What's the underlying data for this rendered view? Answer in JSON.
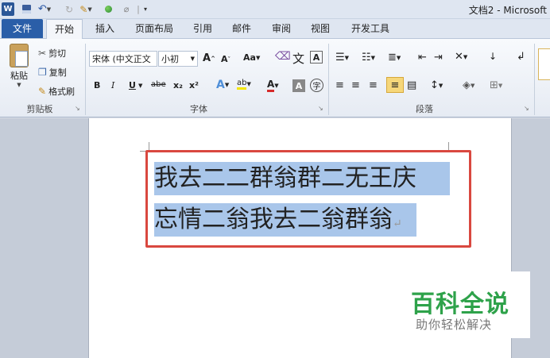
{
  "title_bar": {
    "app_icon_letter": "W",
    "window_title": "文档2 - Microsoft"
  },
  "tabs": [
    {
      "label": "文件"
    },
    {
      "label": "开始"
    },
    {
      "label": "插入"
    },
    {
      "label": "页面布局"
    },
    {
      "label": "引用"
    },
    {
      "label": "邮件"
    },
    {
      "label": "审阅"
    },
    {
      "label": "视图"
    },
    {
      "label": "开发工具"
    }
  ],
  "ribbon": {
    "clipboard": {
      "paste_label": "粘贴",
      "cut_label": "剪切",
      "copy_label": "复制",
      "format_painter_label": "格式刷",
      "group_label": "剪贴板"
    },
    "font": {
      "font_name": "宋体 (中文正文",
      "font_size": "小初",
      "grow_label": "A",
      "shrink_label": "A",
      "change_case_label": "Aa",
      "phonetic_label": "文",
      "char_border_label": "A",
      "bold_label": "B",
      "italic_label": "I",
      "underline_label": "U",
      "strike_label": "abe",
      "subscript_label": "x₂",
      "superscript_label": "x²",
      "text_effect_label": "A",
      "highlight_label": "ab",
      "font_color_label": "A",
      "char_shading_label": "A",
      "enclose_label": "字",
      "group_label": "字体"
    },
    "paragraph": {
      "group_label": "段落"
    }
  },
  "document": {
    "line1": "我去二二群翁群二无王庆",
    "line2": "忘情二翁我去二翁群翁",
    "paragraph_mark": "↵"
  },
  "watermark": {
    "logo_text": "百科全说",
    "subtitle": "助你轻松解决"
  },
  "colors": {
    "file_tab": "#2a5ea8",
    "selection": "#a9c6ea",
    "highlight_border": "#d9483f",
    "watermark_green": "#2ea24a"
  }
}
